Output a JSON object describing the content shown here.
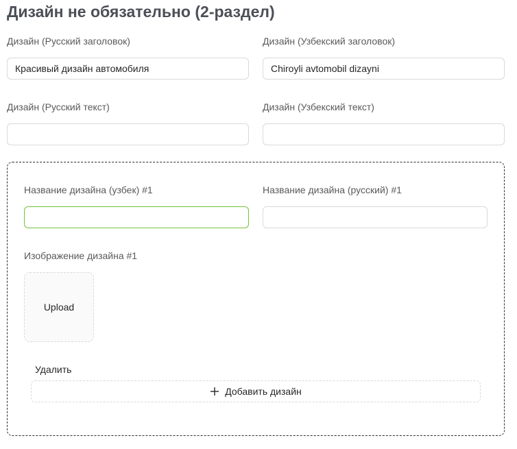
{
  "section": {
    "title": "Дизайн не обязательно (2-раздел)"
  },
  "fields": {
    "ru_heading": {
      "label": "Дизайн (Русский заголовок)",
      "value": "Красивый дизайн автомобиля"
    },
    "uz_heading": {
      "label": "Дизайн (Узбекский заголовок)",
      "value": "Chiroyli avtomobil dizayni"
    },
    "ru_text": {
      "label": "Дизайн (Русский текст)",
      "value": ""
    },
    "uz_text": {
      "label": "Дизайн (Узбекский текст)",
      "value": ""
    }
  },
  "design_item": {
    "name_uz_label": "Название дизайна (узбек) #1",
    "name_uz_value": "",
    "name_ru_label": "Название дизайна (русский) #1",
    "name_ru_value": "",
    "image_label": "Изображение дизайна #1",
    "upload_label": "Upload",
    "delete_label": "Удалить"
  },
  "add_button": {
    "label": "Добавить дизайн",
    "icon": "plus-icon"
  },
  "colors": {
    "focus_border": "#73c23d",
    "input_border": "#d9d9d9",
    "title_color": "#4b4f56"
  }
}
